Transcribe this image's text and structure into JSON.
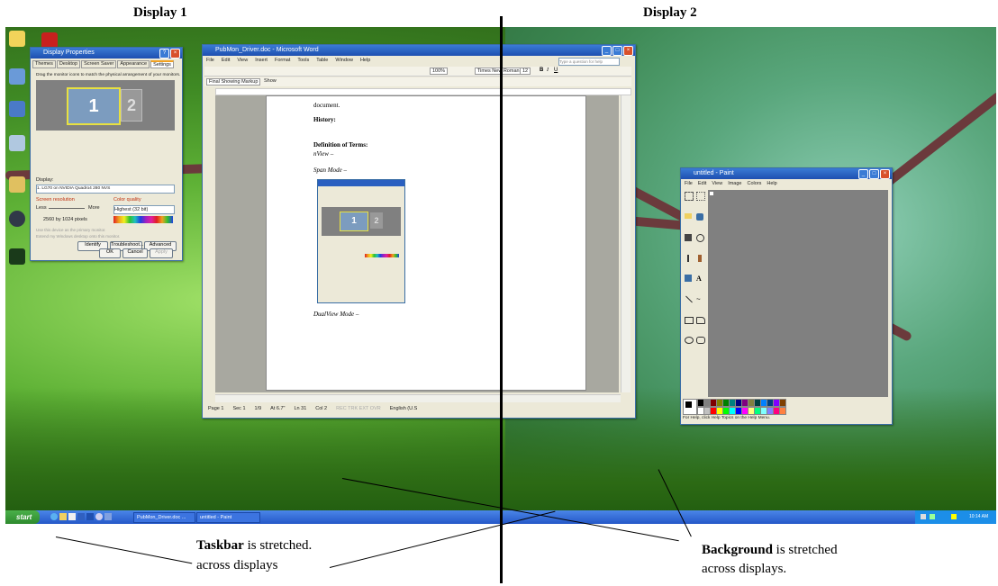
{
  "headings": {
    "display1": "Display 1",
    "display2": "Display 2"
  },
  "captions": {
    "taskbar_bold": "Taskbar",
    "taskbar_rest": " is stretched.",
    "taskbar_line2": "across displays",
    "background_bold": "Background",
    "background_rest": " is stretched",
    "background_line2": "across displays."
  },
  "display_props": {
    "title": "Display Properties",
    "tabs": [
      "Themes",
      "Desktop",
      "Screen Saver",
      "Appearance",
      "Settings"
    ],
    "instruction": "Drag the monitor icons to match the physical arrangement of your monitors.",
    "monitor1": "1",
    "monitor2": "2",
    "display_label": "Display:",
    "display_value": "1. LG70 on NVIDIA Quadro4 280 NVS",
    "resolution_label": "Screen resolution",
    "less": "Less",
    "more": "More",
    "resolution_value": "2560 by 1024 pixels",
    "color_label": "Color quality",
    "color_value": "Highest (32 bit)",
    "check1": "Use this device as the primary monitor.",
    "check2": "Extend my Windows desktop onto this monitor.",
    "identify": "Identify",
    "troubleshoot": "Troubleshoot...",
    "advanced": "Advanced",
    "ok": "OK",
    "cancel": "Cancel",
    "apply": "Apply"
  },
  "word": {
    "title": "PubMon_Driver.doc - Microsoft Word",
    "menu": [
      "File",
      "Edit",
      "View",
      "Insert",
      "Format",
      "Tools",
      "Table",
      "Window",
      "Help"
    ],
    "help_placeholder": "Type a question for help",
    "zoom": "100%",
    "font": "Times New Roman",
    "font_size": "12",
    "markup": "Final Showing Markup",
    "show": "Show",
    "doc_lines": {
      "document": "document.",
      "history": "History:",
      "definition": "Definition of Terms:",
      "nview": "nView –",
      "span": "Span Mode –",
      "dualview": "DualView Mode –"
    },
    "status": {
      "page": "Page 1",
      "sec": "Sec 1",
      "pages": "1/9",
      "at": "At 6.7\"",
      "ln": "Ln 31",
      "col": "Col 2",
      "modes": "REC TRK EXT OVR",
      "lang": "English (U.S"
    }
  },
  "paint": {
    "title": "untitled - Paint",
    "menu": [
      "File",
      "Edit",
      "View",
      "Image",
      "Colors",
      "Help"
    ],
    "status": "For Help, click Help Topics on the Help Menu."
  },
  "taskbar": {
    "start": "start",
    "item1": "PubMon_Driver.doc ...",
    "item2": "untitled - Paint",
    "clock": "10:14 AM"
  },
  "colors": {
    "taskbar": "#3168d5",
    "start": "#3c9a3c",
    "palette": [
      "#000000",
      "#808080",
      "#800000",
      "#808000",
      "#008000",
      "#008080",
      "#000080",
      "#800080",
      "#808040",
      "#004040",
      "#0080ff",
      "#004080",
      "#8000ff",
      "#804000",
      "#ffffff",
      "#c0c0c0",
      "#ff0000",
      "#ffff00",
      "#00ff00",
      "#00ffff",
      "#0000ff",
      "#ff00ff",
      "#ffff80",
      "#00ff80",
      "#80ffff",
      "#8080ff",
      "#ff0080",
      "#ff8040"
    ]
  }
}
